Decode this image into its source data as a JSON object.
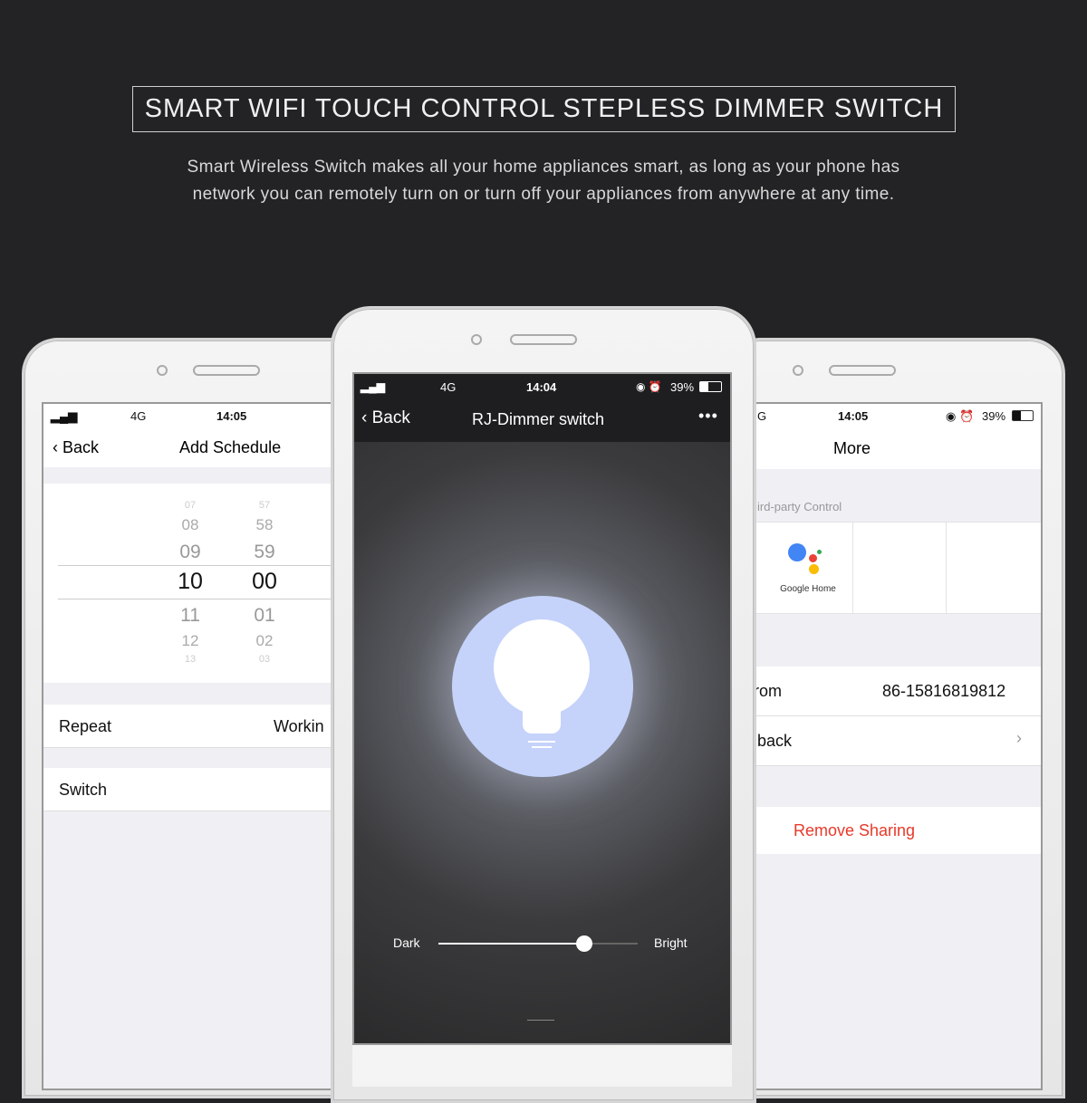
{
  "header": {
    "title": "SMART WIFI TOUCH CONTROL STEPLESS DIMMER SWITCH",
    "subtitle_line1": "Smart Wireless Switch makes all your home appliances smart, as long as your phone has",
    "subtitle_line2": "network you can remotely turn on or turn off your appliances from anywhere at any time."
  },
  "left_phone": {
    "status": {
      "network": "4G",
      "time": "14:05"
    },
    "back": "Back",
    "title": "Add Schedule",
    "hours": [
      "07",
      "08",
      "09",
      "10",
      "11",
      "12",
      "13"
    ],
    "minutes": [
      "57",
      "58",
      "59",
      "00",
      "01",
      "02",
      "03"
    ],
    "repeat_label": "Repeat",
    "repeat_value": "Workin",
    "switch_label": "Switch"
  },
  "center_phone": {
    "status": {
      "network": "4G",
      "time": "14:04",
      "battery": "39%"
    },
    "back": "Back",
    "title": "RJ-Dimmer switch",
    "slider": {
      "min_label": "Dark",
      "max_label": "Bright",
      "value_percent": 73
    },
    "colors": {
      "bulb_circle": "#c5d3fb",
      "background": "#333333"
    }
  },
  "right_phone": {
    "status": {
      "network": "G",
      "time": "14:05",
      "battery": "39%"
    },
    "title": "More",
    "section": "ird-party Control",
    "google_home": "Google Home",
    "from_label": "rom",
    "from_value": "86-15816819812",
    "feedback_label": "back",
    "remove": "Remove Sharing",
    "colors": {
      "remove": "#e8392a"
    }
  }
}
